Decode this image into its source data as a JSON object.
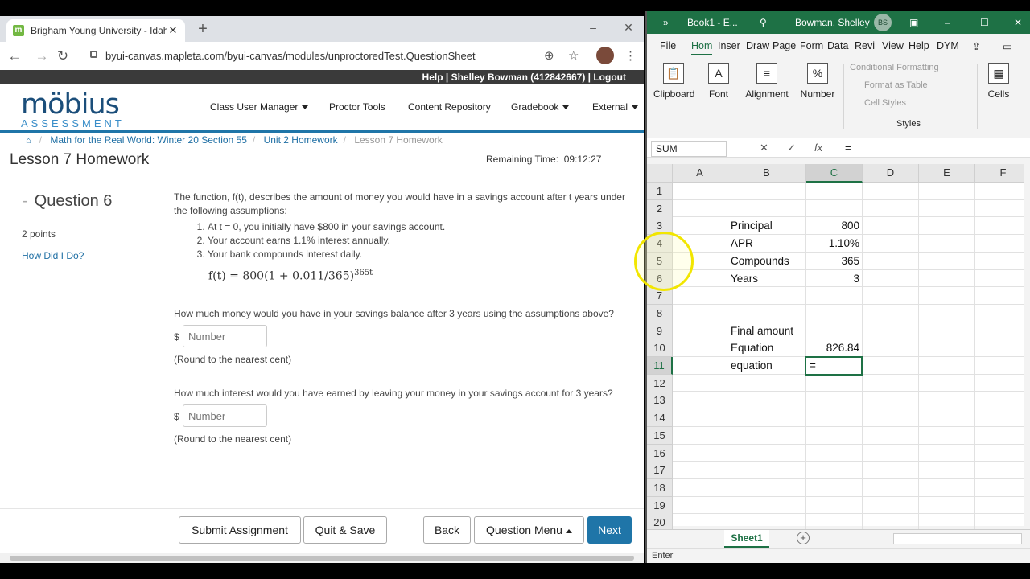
{
  "browser": {
    "tab_title": "Brigham Young University - Idaho",
    "favicon": "m",
    "url": "byui-canvas.mapleta.com/byui-canvas/modules/unproctoredTest.QuestionSheet"
  },
  "mobius": {
    "topbar": "Help | Shelley Bowman (412842667) | Logout",
    "logo_main": "möbius",
    "logo_sub": "ASSESSMENT",
    "menu": [
      "Class User Manager",
      "Proctor Tools",
      "Content Repository",
      "Gradebook",
      "External"
    ],
    "breadcrumb": [
      "Math for the Real World: Winter 20 Section 55",
      "Unit 2 Homework",
      "Lesson 7 Homework"
    ],
    "page_title": "Lesson 7 Homework",
    "remaining_label": "Remaining Time:",
    "remaining_value": "09:12:27",
    "question_label": "Question 6",
    "points": "2 points",
    "how_did_i_do": "How Did I Do?",
    "intro": "The function, f(t), describes the amount of money you would have in a savings account after t years under the following assumptions:",
    "assumptions": [
      "At t = 0, you initially have $800 in your savings account.",
      "Your account earns 1.1% interest annually.",
      "Your bank compounds interest daily."
    ],
    "formula": "f(t) = 800(1 + 0.011/365)",
    "formula_exp": "365t",
    "q1": "How much money would you have in your savings balance after 3 years using the assumptions above?",
    "q2": "How much interest would you have earned by leaving your money in your savings account for 3 years?",
    "dollar": "$",
    "input_placeholder": "Number",
    "round_note": "(Round to the nearest cent)",
    "buttons": {
      "submit": "Submit Assignment",
      "quit": "Quit & Save",
      "back": "Back",
      "question_menu": "Question Menu",
      "next": "Next"
    }
  },
  "excel": {
    "title": "Book1 - E...",
    "user": "Bowman, Shelley",
    "user_initials": "BS",
    "menu": [
      "File",
      "Hom",
      "Inser",
      "Draw",
      "Page",
      "Form",
      "Data",
      "Revi",
      "View",
      "Help",
      "DYM"
    ],
    "ribbon_groups": [
      "Clipboard",
      "Font",
      "Alignment",
      "Number",
      "Cells"
    ],
    "styles_items": [
      "Conditional Formatting",
      "Format as Table",
      "Cell Styles"
    ],
    "styles_label": "Styles",
    "name_box": "SUM",
    "formula": "=",
    "columns": [
      "A",
      "B",
      "C",
      "D",
      "E",
      "F"
    ],
    "rows": [
      "1",
      "2",
      "3",
      "4",
      "5",
      "6",
      "7",
      "8",
      "9",
      "10",
      "11",
      "12",
      "13",
      "14",
      "15",
      "16",
      "17",
      "18",
      "19",
      "20"
    ],
    "cells": {
      "b3": "Principal",
      "c3": "800",
      "b4": "APR",
      "c4": "1.10%",
      "b5": "Compounds",
      "c5": "365",
      "b6": "Years",
      "c6": "3",
      "b9": "Final amount",
      "b10": "Equation",
      "c10": "826.84",
      "b11": "equation",
      "c11": "="
    },
    "sheet_tab": "Sheet1",
    "status": "Enter",
    "colors": {
      "accent": "#1e7145"
    }
  }
}
